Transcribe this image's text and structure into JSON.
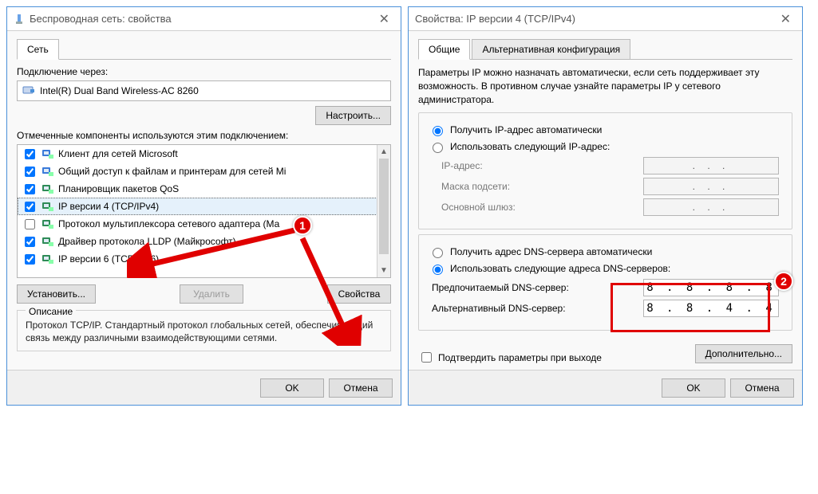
{
  "left": {
    "title": "Беспроводная сеть: свойства",
    "tab": "Сеть",
    "connect_label": "Подключение через:",
    "adapter": "Intel(R) Dual Band Wireless-AC 8260",
    "configure": "Настроить...",
    "components_label": "Отмеченные компоненты используются этим подключением:",
    "items": [
      {
        "checked": true,
        "label": "Клиент для сетей Microsoft",
        "color": "#3a7ad9"
      },
      {
        "checked": true,
        "label": "Общий доступ к файлам и принтерам для сетей Mi",
        "color": "#3a7ad9"
      },
      {
        "checked": true,
        "label": "Планировщик пакетов QoS",
        "color": "#2e8b57"
      },
      {
        "checked": true,
        "label": "IP версии 4 (TCP/IPv4)",
        "color": "#2e8b57",
        "selected": true
      },
      {
        "checked": false,
        "label": "Протокол мультиплексора сетевого адаптера    (Ма",
        "color": "#2e8b57"
      },
      {
        "checked": true,
        "label": "Драйвер протокола LLDP (Майкрософт)",
        "color": "#2e8b57"
      },
      {
        "checked": true,
        "label": "IP версии 6 (TCP/IPv6)",
        "color": "#2e8b57"
      }
    ],
    "install": "Установить...",
    "remove": "Удалить",
    "properties": "Свойства",
    "desc_title": "Описание",
    "desc": "Протокол TCP/IP. Стандартный протокол глобальных сетей, обеспечивающий связь между различными взаимодействующими сетями.",
    "ok": "OK",
    "cancel": "Отмена"
  },
  "right": {
    "title": "Свойства: IP версии 4 (TCP/IPv4)",
    "tab1": "Общие",
    "tab2": "Альтернативная конфигурация",
    "para": "Параметры IP можно назначать автоматически, если сеть поддерживает эту возможность. В противном случае узнайте параметры IP у сетевого администратора.",
    "ip_auto": "Получить IP-адрес автоматически",
    "ip_manual": "Использовать следующий IP-адрес:",
    "ip_addr": "IP-адрес:",
    "mask": "Маска подсети:",
    "gateway": "Основной шлюз:",
    "dns_auto": "Получить адрес DNS-сервера автоматически",
    "dns_manual": "Использовать следующие адреса DNS-серверов:",
    "dns_pref": "Предпочитаемый DNS-сервер:",
    "dns_alt": "Альтернативный DNS-сервер:",
    "dns_pref_val": "8 . 8 . 8 . 8",
    "dns_alt_val": "8 . 8 . 4 . 4",
    "validate": "Подтвердить параметры при выходе",
    "advanced": "Дополнительно...",
    "ok": "OK",
    "cancel": "Отмена"
  },
  "dots": ".     .     ."
}
